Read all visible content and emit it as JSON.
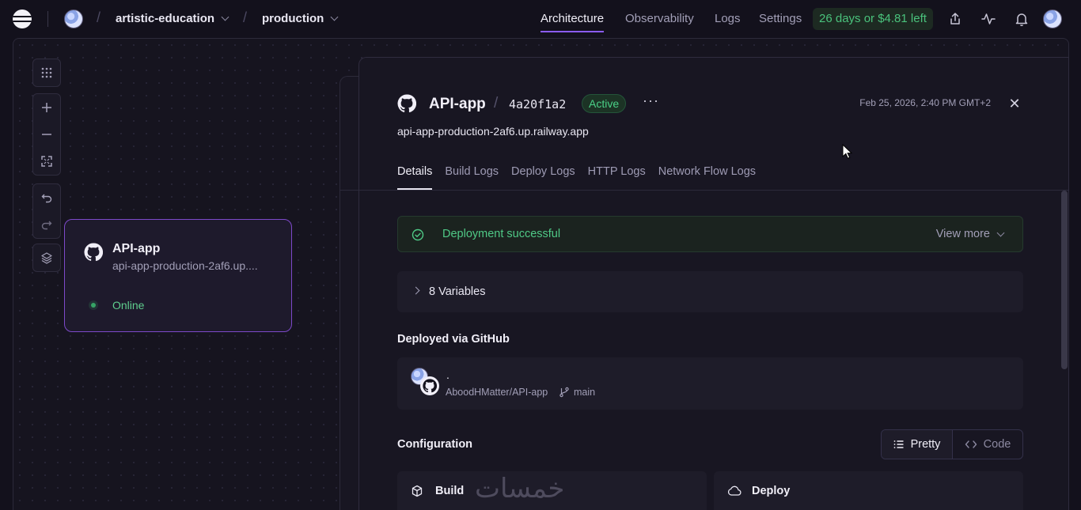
{
  "topbar": {
    "project": "artistic-education",
    "environment": "production",
    "nav": [
      "Architecture",
      "Observability",
      "Logs",
      "Settings"
    ],
    "active_nav": "Architecture",
    "trial_badge": "26 days or $4.81 left"
  },
  "canvas": {
    "service_card": {
      "name": "API-app",
      "url": "api-app-production-2af6.up....",
      "status": "Online"
    }
  },
  "panel": {
    "service_name": "API-app",
    "separator": "/",
    "deploy_hash": "4a20f1a2",
    "status_badge": "Active",
    "timestamp": "Feb 25, 2026, 2:40 PM GMT+2",
    "domain": "api-app-production-2af6.up.railway.app",
    "tabs": [
      "Details",
      "Build Logs",
      "Deploy Logs",
      "HTTP Logs",
      "Network Flow Logs"
    ],
    "active_tab": "Details",
    "deployment_status": "Deployment successful",
    "view_more": "View more",
    "variables_label": "8 Variables",
    "deployed_via_heading": "Deployed via GitHub",
    "commit_message": ".",
    "repo": "AboodHMatter/API-app",
    "branch": "main",
    "configuration_heading": "Configuration",
    "view_modes": [
      "Pretty",
      "Code"
    ],
    "config_cards": [
      "Build",
      "Deploy"
    ],
    "watermark": "خمسات"
  },
  "colors": {
    "accent": "#8b5cf6",
    "success": "#4fc986",
    "background": "#13111c"
  }
}
